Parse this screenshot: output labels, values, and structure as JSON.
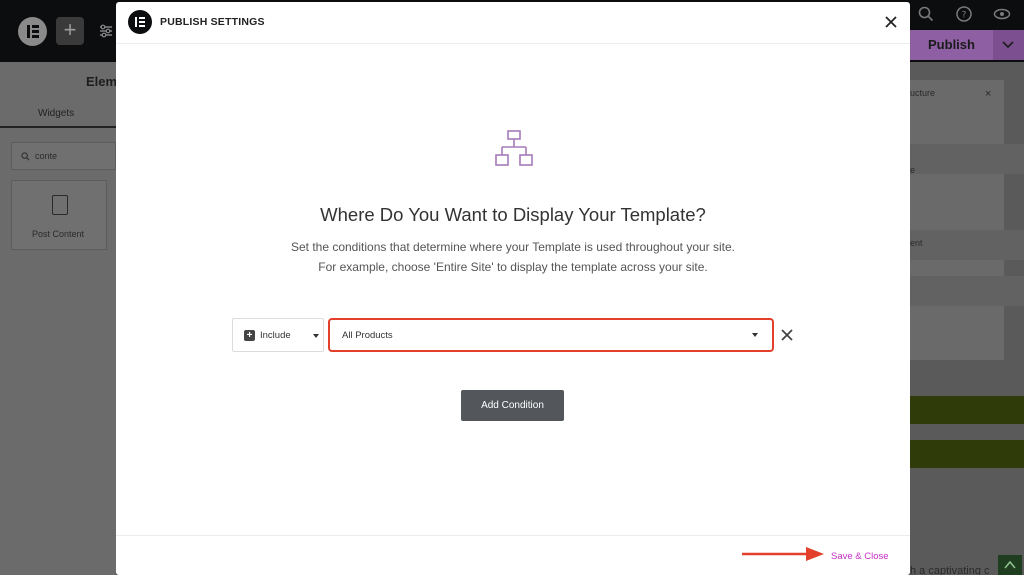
{
  "editor": {
    "panel_title": "Elem",
    "tab_widgets": "Widgets",
    "search_value": "conte",
    "widget_post_content": "Post Content",
    "publish_label": "Publish",
    "right_panel_texts": [
      "ucture",
      "e",
      "ent"
    ],
    "right_panel_bottom_text": "h a captivating c"
  },
  "modal": {
    "title": "PUBLISH SETTINGS",
    "heading": "Where Do You Want to Display Your Template?",
    "description_line1": "Set the conditions that determine where your Template is used throughout your site.",
    "description_line2": "For example, choose 'Entire Site' to display the template across your site.",
    "condition": {
      "type_label": "Include",
      "value_label": "All Products"
    },
    "add_condition_label": "Add Condition",
    "save_close_label": "Save & Close"
  },
  "colors": {
    "accent_purple": "#8e5fa2",
    "save_close_link": "#c42fc4",
    "highlight_border": "#e2402a",
    "arrow": "#e2402a",
    "add_condition_bg": "#53575c"
  }
}
